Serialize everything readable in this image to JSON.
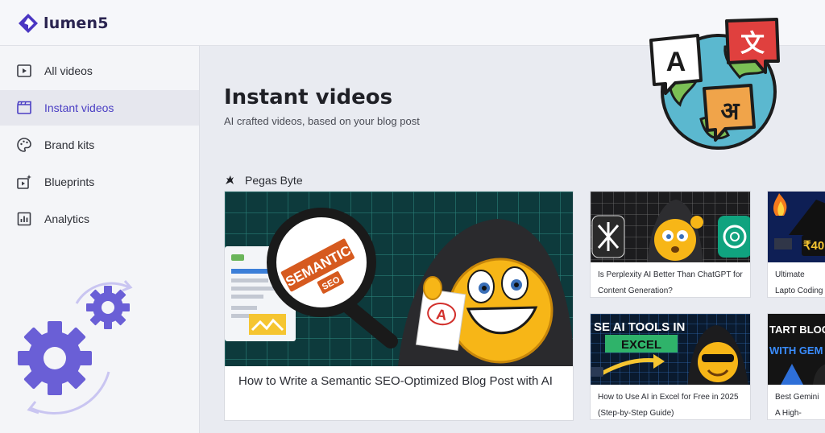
{
  "app": {
    "name": "lumen5"
  },
  "sidebar": {
    "items": [
      {
        "label": "All videos"
      },
      {
        "label": "Instant videos"
      },
      {
        "label": "Brand kits"
      },
      {
        "label": "Blueprints"
      },
      {
        "label": "Analytics"
      }
    ]
  },
  "main": {
    "title": "Instant videos",
    "subtitle": "AI crafted videos, based on your blog post",
    "section": {
      "name": "Pegas Byte"
    },
    "hero_thumb": {
      "badge_line1": "SEMANTIC",
      "badge_line2": "SEO",
      "note": "A"
    },
    "cards": [
      {
        "title": "How to Write a Semantic SEO-Optimized Blog Post with AI"
      },
      {
        "title": "Is Perplexity AI Better Than ChatGPT for Content Generation?"
      },
      {
        "title": "Ultimate Lapto Coding Under"
      },
      {
        "title": "How to Use AI in Excel for Free in 2025 (Step-by-Step Guide)",
        "thumb_line1": "SE AI TOOLS IN",
        "thumb_line2": "EXCEL"
      },
      {
        "title": "Best Gemini A High-Quality B",
        "thumb_line1": "TART BLOG",
        "thumb_line2": "WITH GEM"
      }
    ],
    "price_tag": "₹40"
  },
  "globe": {
    "letter_a": "A",
    "letter_hindi": "अ",
    "letter_kanji": "文"
  },
  "colors": {
    "accent": "#4b3fc4",
    "gear": "#6a5fd6",
    "gear_light": "#9a92e8"
  }
}
